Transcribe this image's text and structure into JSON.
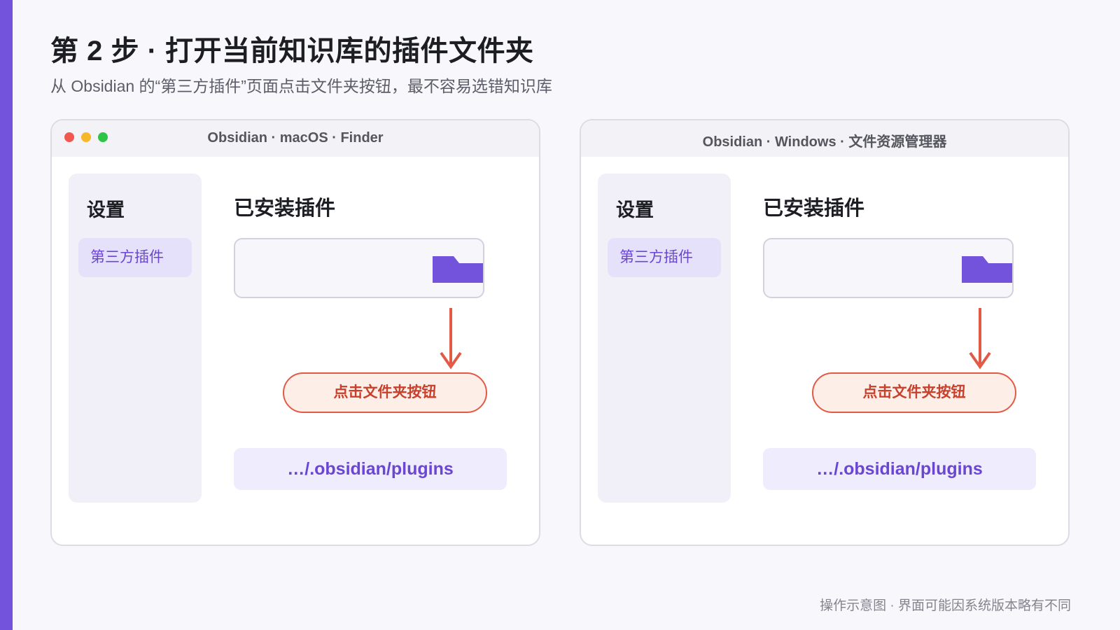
{
  "page": {
    "title": "第 2 步 · 打开当前知识库的插件文件夹",
    "subtitle": "从 Obsidian 的“第三方插件”页面点击文件夹按钮，最不容易选错知识库",
    "footnote": "操作示意图 · 界面可能因系统版本略有不同"
  },
  "colors": {
    "accent": "#7353dc",
    "callout_red": "#e25a46",
    "path_text": "#6a46d3"
  },
  "windows": [
    {
      "title": "Obsidian · macOS · Finder",
      "show_traffic_lights": true,
      "sidebar": {
        "heading": "设置",
        "active_item": "第三方插件"
      },
      "main": {
        "heading": "已安装插件",
        "folder_icon": "folder-icon",
        "callout": "点击文件夹按钮",
        "path": "…/.obsidian/plugins"
      }
    },
    {
      "title": "Obsidian · Windows · 文件资源管理器",
      "show_traffic_lights": false,
      "sidebar": {
        "heading": "设置",
        "active_item": "第三方插件"
      },
      "main": {
        "heading": "已安装插件",
        "folder_icon": "folder-icon",
        "callout": "点击文件夹按钮",
        "path": "…/.obsidian/plugins"
      }
    }
  ]
}
